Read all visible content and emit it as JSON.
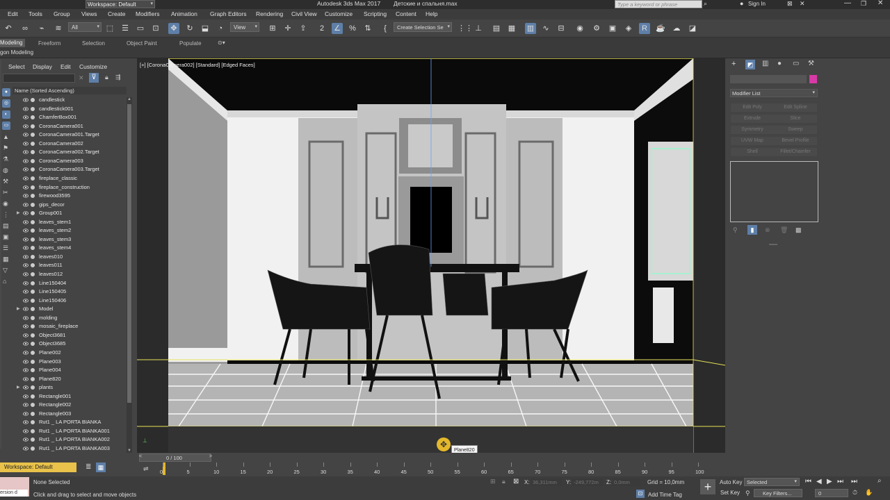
{
  "window": {
    "workspace_label": "Workspace: Default",
    "title": "Autodesk 3ds Max 2017",
    "filename": "Детские и спальня.max",
    "search_placeholder": "Type a keyword or phrase",
    "sign_in": "Sign In"
  },
  "menu": [
    "Edit",
    "Tools",
    "Group",
    "Views",
    "Create",
    "Modifiers",
    "Animation",
    "Graph Editors",
    "Rendering",
    "Civil View",
    "Customize",
    "Scripting",
    "Content",
    "Help"
  ],
  "toolbar": {
    "filter_value": "All",
    "view_value": "View",
    "selection_set_placeholder": "Create Selection Se"
  },
  "ribbon": {
    "tabs": [
      "Modeling",
      "Freeform",
      "Selection",
      "Object Paint",
      "Populate"
    ],
    "sub_label": "gon Modeling"
  },
  "scene_explorer": {
    "menu": [
      "Select",
      "Display",
      "Edit",
      "Customize"
    ],
    "column_header": "Name (Sorted Ascending)",
    "items": [
      {
        "name": "candlestick",
        "expand": false
      },
      {
        "name": "candlestick001",
        "expand": false
      },
      {
        "name": "ChamferBox001",
        "expand": false
      },
      {
        "name": "CoronaCamera001",
        "expand": false
      },
      {
        "name": "CoronaCamera001.Target",
        "expand": false
      },
      {
        "name": "CoronaCamera002",
        "expand": false
      },
      {
        "name": "CoronaCamera002.Target",
        "expand": false
      },
      {
        "name": "CoronaCamera003",
        "expand": false
      },
      {
        "name": "CoronaCamera003.Target",
        "expand": false
      },
      {
        "name": "fireplace_classic",
        "expand": false
      },
      {
        "name": "fireplace_construction",
        "expand": false
      },
      {
        "name": "firewood3595",
        "expand": false
      },
      {
        "name": "gips_decor",
        "expand": false
      },
      {
        "name": "Group001",
        "expand": true
      },
      {
        "name": "leaves_stem1",
        "expand": false
      },
      {
        "name": "leaves_stem2",
        "expand": false
      },
      {
        "name": "leaves_stem3",
        "expand": false
      },
      {
        "name": "leaves_stem4",
        "expand": false
      },
      {
        "name": "leaves010",
        "expand": false
      },
      {
        "name": "leaves011",
        "expand": false
      },
      {
        "name": "leaves012",
        "expand": false
      },
      {
        "name": "Line150404",
        "expand": false
      },
      {
        "name": "Line150405",
        "expand": false
      },
      {
        "name": "Line150406",
        "expand": false
      },
      {
        "name": "Model",
        "expand": true
      },
      {
        "name": "molding",
        "expand": false
      },
      {
        "name": "mosaic_fireplace",
        "expand": false
      },
      {
        "name": "Object3681",
        "expand": false
      },
      {
        "name": "Object3685",
        "expand": false
      },
      {
        "name": "Plane002",
        "expand": false
      },
      {
        "name": "Plane003",
        "expand": false
      },
      {
        "name": "Plane004",
        "expand": false
      },
      {
        "name": "Plane820",
        "expand": false
      },
      {
        "name": "plants",
        "expand": true
      },
      {
        "name": "Rectangle001",
        "expand": false
      },
      {
        "name": "Rectangle002",
        "expand": false
      },
      {
        "name": "Rectangle003",
        "expand": false
      },
      {
        "name": "Rut1 _ LA PORTA BIANKA",
        "expand": false
      },
      {
        "name": "Rut1 _ LA PORTA BIANKA001",
        "expand": false
      },
      {
        "name": "Rut1 _ LA PORTA BIANKA002",
        "expand": false
      },
      {
        "name": "Rut1 _ LA PORTA BIANKA003",
        "expand": false
      }
    ],
    "workspace_label": "Workspace: Default"
  },
  "viewport": {
    "label": "[+] [CoronaCamera002] [Standard] [Edged Faces]",
    "tooltip": "Plane820"
  },
  "command_panel": {
    "modifier_list": "Modifier List",
    "buttons": [
      "Edit Poly",
      "Edit Spline",
      "Extrude",
      "Slice",
      "Symmetry",
      "Sweep",
      "UVW Map",
      "Bevel Profile",
      "Shell",
      "Fillet/Chamfer"
    ],
    "color_swatch": "#d63aa6"
  },
  "timeline": {
    "frame_label": "0 / 100",
    "ticks": [
      "0",
      "5",
      "10",
      "15",
      "20",
      "25",
      "30",
      "35",
      "40",
      "45",
      "50",
      "55",
      "60",
      "65",
      "70",
      "75",
      "80",
      "85",
      "90",
      "95",
      "100"
    ]
  },
  "status": {
    "prompt_label": "ersion d",
    "selection": "None Selected",
    "hint": "Click and drag to select and move objects",
    "x_label": "X:",
    "x_value": "36,311mm",
    "y_label": "Y:",
    "y_value": "-249,772m",
    "z_label": "Z:",
    "z_value": "0,0mm",
    "grid": "Grid = 10,0mm",
    "add_time_tag": "Add Time Tag",
    "auto_key": "Auto Key",
    "set_key": "Set Key",
    "selected_value": "Selected",
    "key_filters": "Key Filters...",
    "frame_value": "0"
  }
}
